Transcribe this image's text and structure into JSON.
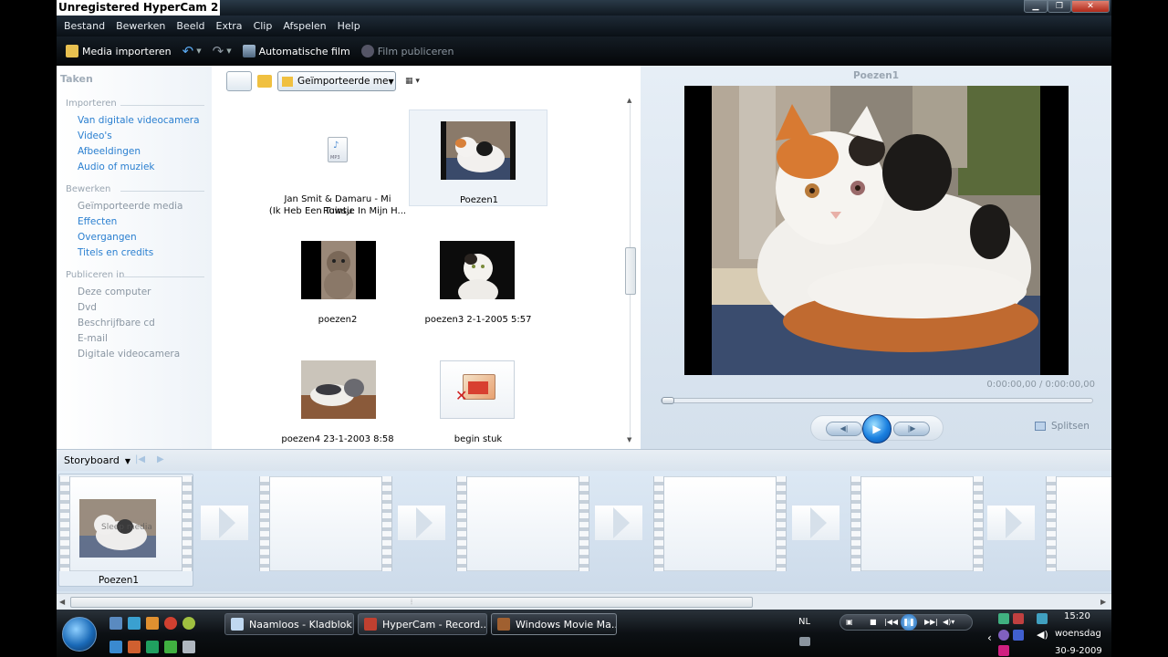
{
  "window": {
    "title": "Unregistered HyperCam 2"
  },
  "menu": [
    "Bestand",
    "Bewerken",
    "Beeld",
    "Extra",
    "Clip",
    "Afspelen",
    "Help"
  ],
  "toolbar": {
    "import_label": "Media importeren",
    "auto_movie_label": "Automatische film",
    "publish_label": "Film publiceren"
  },
  "tasks": {
    "title": "Taken",
    "import_header": "Importeren",
    "import_links": [
      "Van digitale videocamera",
      "Video's",
      "Afbeeldingen",
      "Audio of muziek"
    ],
    "edit_header": "Bewerken",
    "edit_links": [
      "Geïmporteerde media",
      "Effecten",
      "Overgangen",
      "Titels en credits"
    ],
    "publish_header": "Publiceren in",
    "publish_links": [
      "Deze computer",
      "Dvd",
      "Beschrijfbare cd",
      "E-mail",
      "Digitale videocamera"
    ]
  },
  "collection": {
    "dropdown_value": "Geïmporteerde me",
    "items": [
      {
        "line1": "Jan Smit & Damaru - Mi Rowsu",
        "line2": "(Ik Heb Een Tuintje In Mijn H...",
        "icon": "mp3-file-icon",
        "icon_text": "MP3"
      },
      {
        "line1": "Poezen1",
        "line2": "",
        "icon": "cat-photo"
      },
      {
        "line1": "poezen2",
        "line2": "",
        "icon": "cat-photo"
      },
      {
        "line1": "poezen3 2-1-2005 5:57",
        "line2": "",
        "icon": "cat-photo"
      },
      {
        "line1": "poezen4 23-1-2003 8:58",
        "line2": "",
        "icon": "cat-photo"
      },
      {
        "line1": "begin stuk",
        "line2": "",
        "icon": "broken-file-icon"
      }
    ]
  },
  "preview": {
    "title": "Poezen1",
    "timecode": "0:00:00,00 / 0:00:00,00",
    "split_label": "Splitsen",
    "seek_position": 0
  },
  "storyboard": {
    "label": "Storyboard",
    "first_clip": "Poezen1",
    "drag_hint": "Sleep media"
  },
  "taskbar": {
    "tasks": [
      "Naamloos - Kladblok",
      "HyperCam - Record...",
      "Windows Movie Ma..."
    ],
    "language": "NL",
    "time": "15:20",
    "day": "woensdag",
    "date": "30-9-2009"
  },
  "colors": {
    "link_blue": "#2a7fd0",
    "link_gray": "#8a96a2",
    "accent_blue": "#1a80e0"
  }
}
